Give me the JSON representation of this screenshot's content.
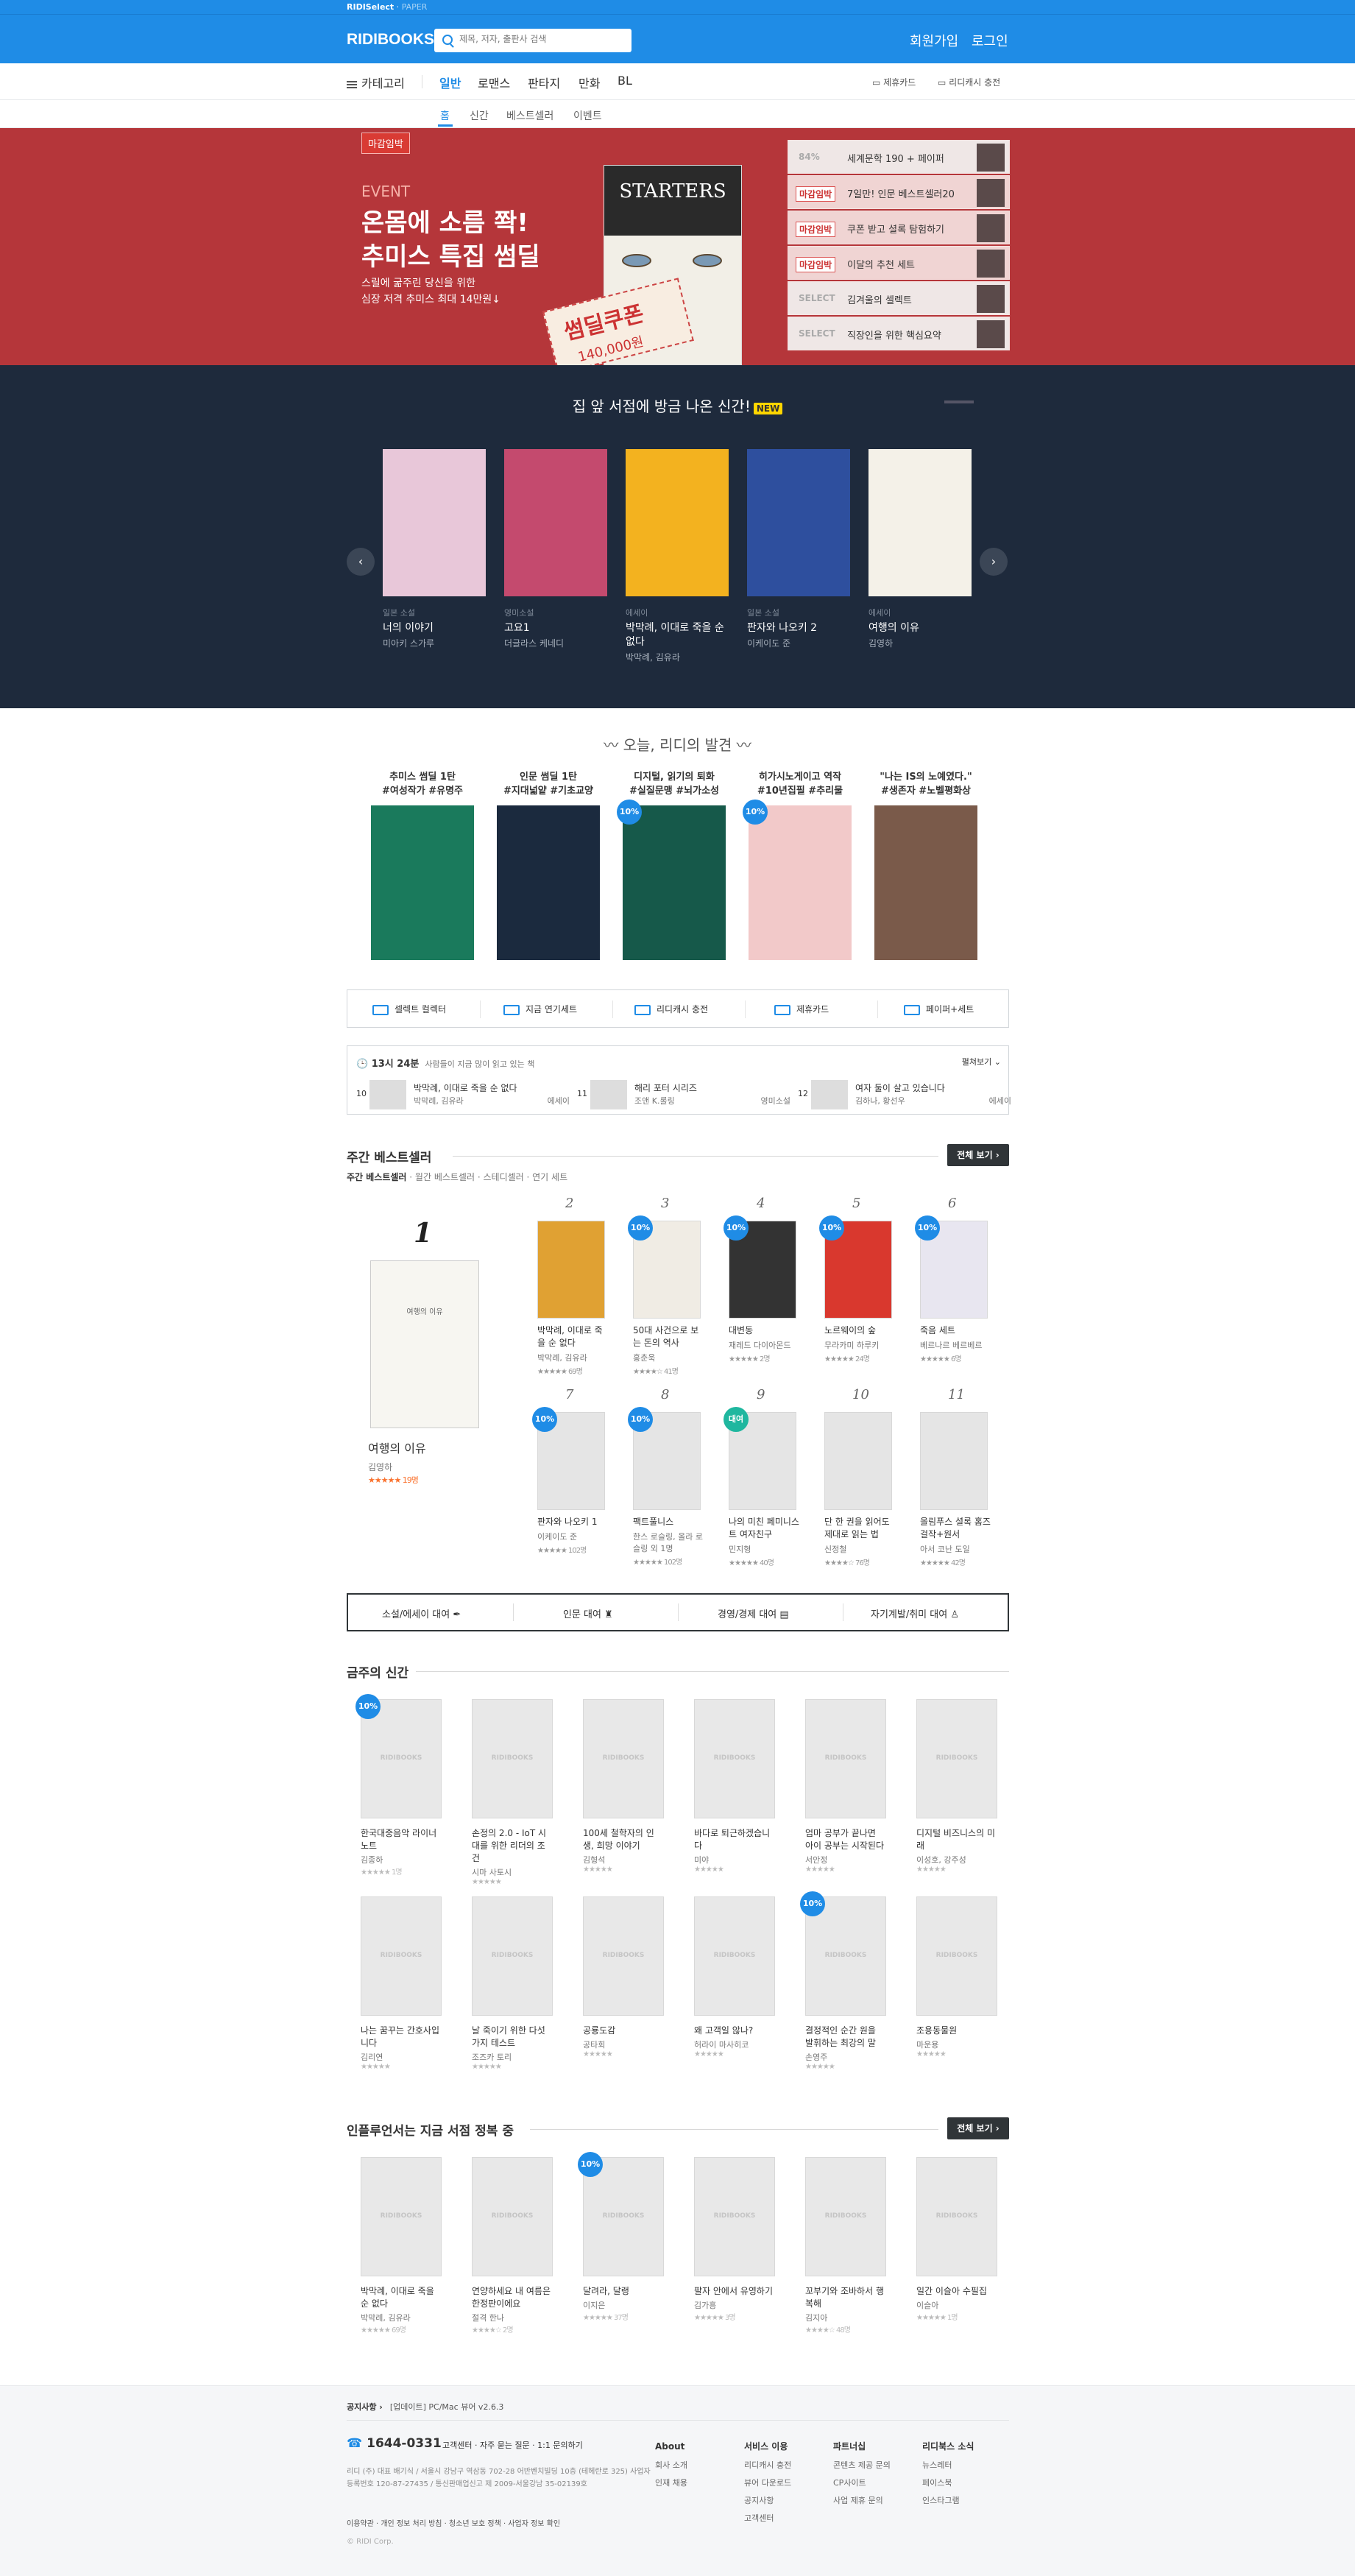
{
  "topbar": {
    "brand": "RIDISelect",
    "paper": "PAPER"
  },
  "header": {
    "logo": "RIDIBOOKS",
    "search_placeholder": "제목, 저자, 출판사 검색",
    "signup": "회원가입",
    "login": "로그인"
  },
  "nav": {
    "category": "카테고리",
    "tabs": [
      "일반",
      "로맨스",
      "판타지",
      "만화",
      "BL"
    ],
    "right": [
      "제휴카드",
      "리디캐시 충전"
    ]
  },
  "subnav": [
    "홈",
    "신간",
    "베스트셀러",
    "이벤트"
  ],
  "hero": {
    "tag": "마감임박",
    "event": "EVENT",
    "title1": "온몸에 소름 쫙!",
    "title2": "추미스 특집 썸딜",
    "desc1": "스릴에 굶주린 당신을 위한",
    "desc2": "심장 저격 추미스 최대 14만원↓",
    "book_title": "STARTERS",
    "coupon": "썸딜쿠폰",
    "coupon_amount": "140,000원",
    "list": [
      {
        "label": "84%",
        "text": "세계문학 190 + 페이퍼"
      },
      {
        "label": "마감임박",
        "text": "7일만! 인문 베스트셀러20"
      },
      {
        "label": "마감임박",
        "text": "쿠폰 받고 셜록 탐험하기"
      },
      {
        "label": "마감임박",
        "text": "이달의 추천 세트"
      },
      {
        "label": "SELECT",
        "text": "김겨울의 셀렉트"
      },
      {
        "label": "SELECT",
        "text": "직장인을 위한 핵심요약"
      }
    ]
  },
  "carousel": {
    "title": "집 앞 서점에 방금 나온 신간!",
    "badge": "NEW",
    "prev": "‹",
    "next": "›",
    "books": [
      {
        "genre": "일본 소설",
        "title": "너의 이야기",
        "author": "미아키 스가루",
        "color": "#e8c7d9"
      },
      {
        "genre": "영미소설",
        "title": "고요1",
        "author": "더글라스 케네디",
        "color": "#c44a6e"
      },
      {
        "genre": "에세이",
        "title": "박막례, 이대로 죽을 순 없다",
        "author": "박막례, 김유라",
        "color": "#f3b21f"
      },
      {
        "genre": "일본 소설",
        "title": "판자와 나오키 2",
        "author": "이케이도 준",
        "color": "#2e4f9e"
      },
      {
        "genre": "에세이",
        "title": "여행의 이유",
        "author": "김영하",
        "color": "#f4f1e8"
      }
    ]
  },
  "today": {
    "title": "오늘, 리디의 발견",
    "books": [
      {
        "desc1": "추미스 썸딜 1탄",
        "desc2": "#여성작가 #유명주",
        "color": "#1a7a5c",
        "badge": ""
      },
      {
        "desc1": "인문 썸딜 1탄",
        "desc2": "#지대넓얕 #기초교양",
        "color": "#1b2a3e",
        "badge": ""
      },
      {
        "desc1": "디지털, 읽기의 퇴화",
        "desc2": "#실질문맹 #뇌가소성",
        "color": "#16594a",
        "badge": "10%"
      },
      {
        "desc1": "히가시노게이고 역작",
        "desc2": "#10년집필 #추리물",
        "color": "#f2c9c9",
        "badge": "10%"
      },
      {
        "desc1": "\"나는 IS의 노예였다.\"",
        "desc2": "#생존자 #노벨평화상",
        "color": "#7a5a4a",
        "badge": ""
      }
    ]
  },
  "quick": [
    "셀렉트 컬렉터",
    "지금 연기세트",
    "리디캐시 충전",
    "제휴카드",
    "페이퍼+세트"
  ],
  "realtime": {
    "time": "13시 24분",
    "desc": "사람들이 지금 많이 읽고 있는 책",
    "fold": "펼쳐보기",
    "items": [
      {
        "rank": "10",
        "title": "박막례, 이대로 죽을 순 없다",
        "author": "박막례, 김유라",
        "cat": "에세이"
      },
      {
        "rank": "11",
        "title": "해리 포터 시리즈",
        "author": "조앤 K.롤링",
        "cat": "영미소설"
      },
      {
        "rank": "12",
        "title": "여자 둘이 살고 있습니다",
        "author": "김하나, 황선우",
        "cat": "에세이"
      }
    ]
  },
  "best": {
    "title": "주간 베스트셀러",
    "more": "전체 보기 ›",
    "tabs": [
      "주간 베스트셀러",
      "월간 베스트셀러",
      "스테디셀러",
      "연기 세트"
    ],
    "first": {
      "rank": "1",
      "title": "여행의 이유",
      "author": "김영하",
      "rating": "★★★★★ 19명"
    },
    "items": [
      {
        "rank": "2",
        "title": "박막례, 이대로 죽을 순 없다",
        "author": "박막례, 김유라",
        "rating": "★★★★★ 69명",
        "badge": "",
        "color": "#e0a133"
      },
      {
        "rank": "3",
        "title": "50대 사건으로 보는 돈의 역사",
        "author": "홍춘욱",
        "rating": "★★★★☆ 41명",
        "badge": "10%",
        "color": "#f0ece4"
      },
      {
        "rank": "4",
        "title": "대변동",
        "author": "재레드 다이아몬드",
        "rating": "★★★★★ 2명",
        "badge": "10%",
        "color": "#333"
      },
      {
        "rank": "5",
        "title": "노르웨이의 숲",
        "author": "무라카미 하루키",
        "rating": "★★★★★ 24명",
        "badge": "10%",
        "color": "#d9382e"
      },
      {
        "rank": "6",
        "title": "죽음 세트",
        "author": "베르나르 베르베르",
        "rating": "★★★★★ 6명",
        "badge": "10%",
        "color": "#e8e6f0"
      },
      {
        "rank": "7",
        "title": "판자와 나오키 1",
        "author": "이케이도 준",
        "rating": "★★★★★ 102명",
        "badge": "10%",
        "color": "#e5e5e5"
      },
      {
        "rank": "8",
        "title": "팩트풀니스",
        "author": "한스 로슬링, 올라 로슬링 외 1명",
        "rating": "★★★★★ 102명",
        "badge": "10%",
        "color": "#e5e5e5"
      },
      {
        "rank": "9",
        "title": "나의 미친 페미니스트 여자친구",
        "author": "민지형",
        "rating": "★★★★★ 40명",
        "badge": "대여",
        "color": "#e5e5e5"
      },
      {
        "rank": "10",
        "title": "단 한 권을 읽어도 제대로 읽는 법",
        "author": "신정철",
        "rating": "★★★★☆ 76명",
        "badge": "",
        "color": "#e5e5e5"
      },
      {
        "rank": "11",
        "title": "올림푸스 셜록 홈즈 걸작+원서",
        "author": "아서 코난 도일",
        "rating": "★★★★★ 42명",
        "badge": "",
        "color": "#e5e5e5"
      }
    ]
  },
  "catbar": [
    "소설/에세이 대여",
    "인문 대여",
    "경영/경제 대여",
    "자기계발/취미 대여"
  ],
  "newbooks": {
    "title": "금주의 신간",
    "watermark": "RIDIBOOKS",
    "items": [
      {
        "title": "한국대중음악 라이너노트",
        "author": "김종하",
        "rating": "★★★★★ 1명",
        "badge": "10%"
      },
      {
        "title": "손정의 2.0 - IoT 시대를 위한 리더의 조건",
        "author": "시마 사토시",
        "rating": "★★★★★",
        "badge": ""
      },
      {
        "title": "100세 철학자의 인생, 희망 이야기",
        "author": "김형석",
        "rating": "★★★★★",
        "badge": ""
      },
      {
        "title": "바다로 퇴근하겠습니다",
        "author": "미야",
        "rating": "★★★★★",
        "badge": ""
      },
      {
        "title": "엄마 공부가 끝나면 아이 공부는 시작된다",
        "author": "서안정",
        "rating": "★★★★★",
        "badge": ""
      },
      {
        "title": "디지털 비즈니스의 미래",
        "author": "이성호, 강주성",
        "rating": "★★★★★",
        "badge": ""
      },
      {
        "title": "나는 꿈꾸는 간호사입니다",
        "author": "김리연",
        "rating": "★★★★★",
        "badge": ""
      },
      {
        "title": "날 죽이기 위한 다섯 가지 테스트",
        "author": "조즈카 토리",
        "rating": "★★★★★",
        "badge": ""
      },
      {
        "title": "공룡도감",
        "author": "공타회",
        "rating": "★★★★★",
        "badge": ""
      },
      {
        "title": "왜 고객일 않나?",
        "author": "허라이 마사히코",
        "rating": "★★★★★",
        "badge": ""
      },
      {
        "title": "결정적인 순간 원을 발휘하는 최강의 말",
        "author": "손영주",
        "rating": "★★★★★",
        "badge": "10%"
      },
      {
        "title": "조용동물원",
        "author": "마운용",
        "rating": "★★★★★",
        "badge": ""
      }
    ]
  },
  "influencer": {
    "title": "인플루언서는 지금 서점 정복 중",
    "more": "전체 보기 ›",
    "items": [
      {
        "title": "박막례, 이대로 죽을 순 없다",
        "author": "박막례, 김유라",
        "rating": "★★★★★ 69명",
        "badge": ""
      },
      {
        "title": "연양하세요 내 여름은 한정판이에요",
        "author": "절격 한나",
        "rating": "★★★★☆ 2명",
        "badge": ""
      },
      {
        "title": "달려라, 달랭",
        "author": "이지은",
        "rating": "★★★★★ 37명",
        "badge": "10%"
      },
      {
        "title": "팔자 안에서 유영하기",
        "author": "김가흥",
        "rating": "★★★★★ 3명",
        "badge": ""
      },
      {
        "title": "꼬부기와 조바하서 행복해",
        "author": "김지아",
        "rating": "★★★★☆ 48명",
        "badge": ""
      },
      {
        "title": "일간 이슬아 수필집",
        "author": "이슬아",
        "rating": "★★★★★ 1명",
        "badge": ""
      }
    ]
  },
  "footer": {
    "notice_label": "공지사항 ›",
    "notice": "[업데이트] PC/Mac 뷰어 v2.6.3",
    "phone": "1644-0331",
    "cs": "고객센터 · 자주 묻는 질문 · 1:1 문의하기",
    "info": "리디 (주) 대표 배기식 / 서울시 강남구 역삼동 702-28 어반벤치빌딩 10층 (테헤란로 325) 사업자등록번호 120-87-27435 / 통신판매업신고 제 2009-서울강남 35-02139호",
    "policy": "이용약관 · 개인 정보 처리 방침 · 청소년 보호 정책 · 사업자 정보 확인",
    "copyright": "© RIDI Corp.",
    "cols": [
      {
        "head": "About",
        "items": [
          "회사 소개",
          "인재 채용"
        ]
      },
      {
        "head": "서비스 이용",
        "items": [
          "리디캐시 충전",
          "뷰어 다운로드",
          "공지사항",
          "고객센터"
        ]
      },
      {
        "head": "파트너십",
        "items": [
          "콘텐츠 제공 문의",
          "CP사이트",
          "사업 제휴 문의"
        ]
      },
      {
        "head": "리디북스 소식",
        "items": [
          "뉴스레터",
          "페이스북",
          "인스타그램"
        ]
      }
    ]
  },
  "colors": {
    "brand": "#1f8ce6",
    "hero": "#b5363a",
    "dark": "#1e2a3c",
    "star": "#fa722e"
  }
}
